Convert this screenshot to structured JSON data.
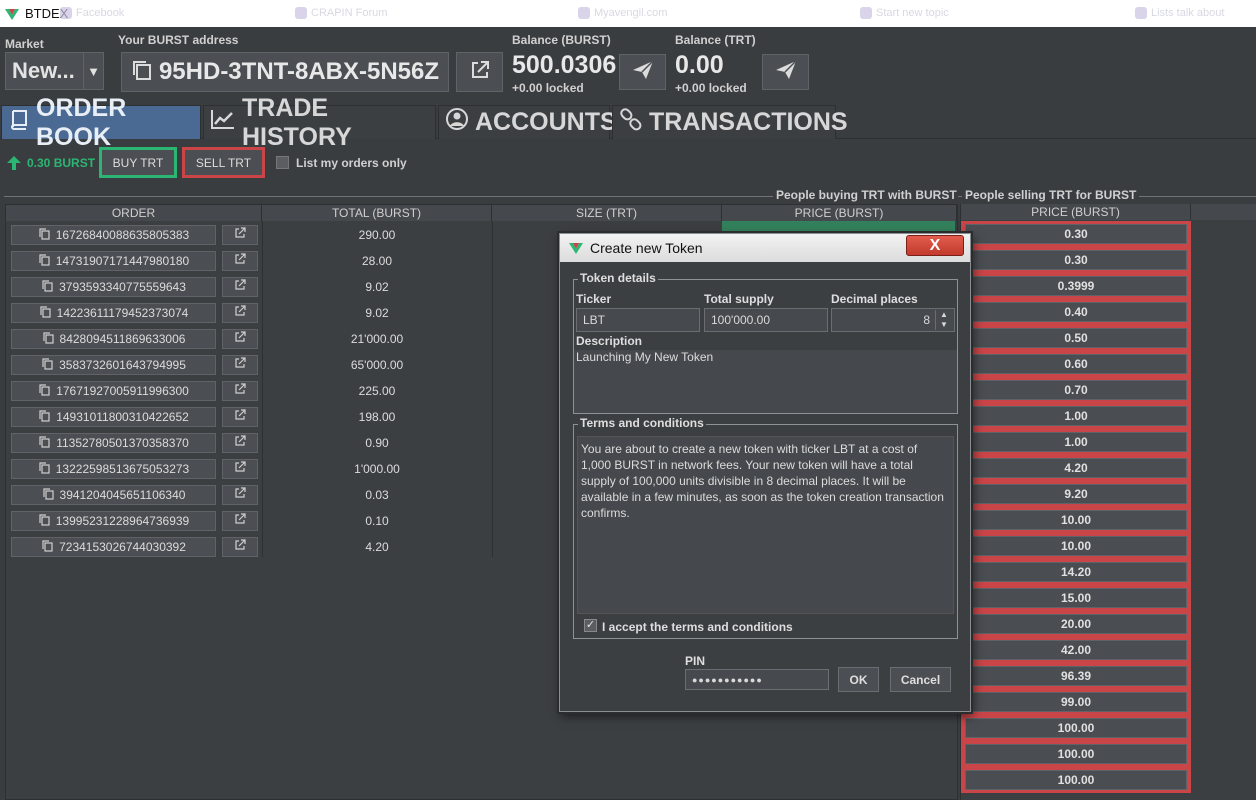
{
  "window": {
    "title": "BTDEX"
  },
  "browser_ghost_tabs": [
    "Facebook",
    "CRAPIN Forum",
    "Myavengil.com",
    "Start new topic",
    "Lists talk about"
  ],
  "header": {
    "market_label": "Market",
    "market_value": "New...",
    "address_label": "Your BURST address",
    "address_value": "95HD-3TNT-8ABX-5N56Z",
    "balance_burst_label": "Balance (BURST)",
    "balance_burst_value": "500.0306",
    "balance_burst_locked": "+0.00 locked",
    "balance_trt_label": "Balance (TRT)",
    "balance_trt_value": "0.00",
    "balance_trt_locked": "+0.00 locked"
  },
  "tabs": [
    {
      "label": "ORDER BOOK",
      "icon": "book-icon",
      "active": true
    },
    {
      "label": "TRADE HISTORY",
      "icon": "chart-line-icon"
    },
    {
      "label": "ACCOUNTS",
      "icon": "user-circle-icon"
    },
    {
      "label": "TRANSACTIONS",
      "icon": "chain-link-icon"
    }
  ],
  "toolbar": {
    "last_price": "0.30 BURST",
    "buy_label": "BUY TRT",
    "sell_label": "SELL TRT",
    "my_orders_label": "List my orders only",
    "buy_color": "#2bb673",
    "sell_color": "#c94548"
  },
  "book": {
    "buy_group_title": "People buying TRT with BURST",
    "sell_group_title": "People selling TRT for BURST",
    "columns": [
      "ORDER",
      "TOTAL (BURST)",
      "SIZE (TRT)",
      "PRICE (BURST)"
    ],
    "sell_price_header": "PRICE (BURST)",
    "rows": [
      {
        "order": "16726840088635805383",
        "total": "290.00"
      },
      {
        "order": "14731907171447980180",
        "total": "28.00"
      },
      {
        "order": "3793593340775559643",
        "total": "9.02"
      },
      {
        "order": "14223611179452373074",
        "total": "9.02"
      },
      {
        "order": "8428094511869633006",
        "total": "21'000.00"
      },
      {
        "order": "3583732601643794995",
        "total": "65'000.00"
      },
      {
        "order": "17671927005911996300",
        "total": "225.00"
      },
      {
        "order": "14931011800310422652",
        "total": "198.00"
      },
      {
        "order": "11352780501370358370",
        "total": "0.90"
      },
      {
        "order": "13222598513675053273",
        "total": "1'000.00"
      },
      {
        "order": "3941204045651106340",
        "total": "0.03"
      },
      {
        "order": "13995231228964736939",
        "total": "0.10"
      },
      {
        "order": "7234153026744030392",
        "total": "4.20"
      }
    ],
    "sell_prices": [
      "0.30",
      "0.30",
      "0.3999",
      "0.40",
      "0.50",
      "0.60",
      "0.70",
      "1.00",
      "1.00",
      "4.20",
      "9.20",
      "10.00",
      "10.00",
      "14.20",
      "15.00",
      "20.00",
      "42.00",
      "96.39",
      "99.00",
      "100.00",
      "100.00",
      "100.00"
    ]
  },
  "dialog": {
    "title": "Create new Token",
    "close_label": "X",
    "token_details_label": "Token details",
    "ticker_label": "Ticker",
    "ticker_value": "LBT",
    "supply_label": "Total supply",
    "supply_value": "100'000.00",
    "decimals_label": "Decimal places",
    "decimals_value": "8",
    "description_label": "Description",
    "description_value": "Launching My New Token",
    "terms_label": "Terms and conditions",
    "terms_text": "You are about to create a new token with ticker LBT at a cost of 1,000 BURST in network fees. Your new token will have a total supply of 100,000 units divisible in 8 decimal places. It will be available in a few minutes, as soon as the token creation transaction confirms.",
    "accept_label": "I accept the terms and conditions",
    "pin_label": "PIN",
    "pin_value": "●●●●●●●●●●●",
    "ok_label": "OK",
    "cancel_label": "Cancel"
  }
}
